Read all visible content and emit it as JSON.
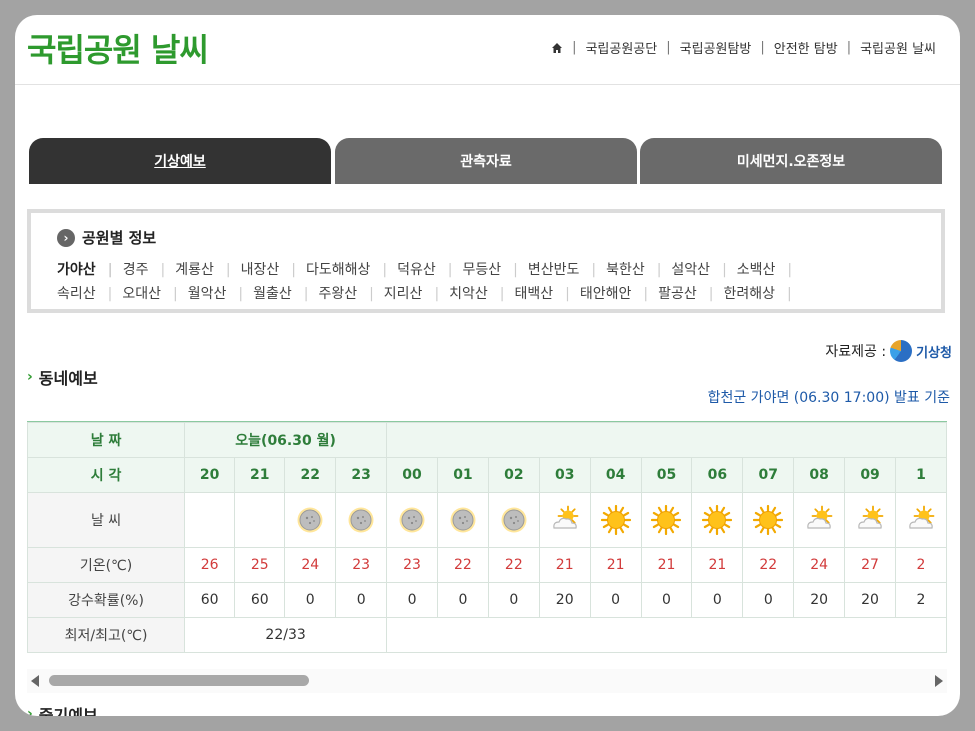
{
  "header": {
    "title": "국립공원 날씨",
    "nav": [
      "국립공원공단",
      "국립공원탐방",
      "안전한 탐방",
      "국립공원 날씨"
    ]
  },
  "tabs": [
    {
      "label": "기상예보",
      "active": true
    },
    {
      "label": "관측자료",
      "active": false
    },
    {
      "label": "미세먼지.오존정보",
      "active": false
    }
  ],
  "park_box": {
    "heading": "공원별 정보",
    "parks": [
      "가야산",
      "경주",
      "계룡산",
      "내장산",
      "다도해해상",
      "덕유산",
      "무등산",
      "변산반도",
      "북한산",
      "설악산",
      "소백산",
      "속리산",
      "오대산",
      "월악산",
      "월출산",
      "주왕산",
      "지리산",
      "치악산",
      "태백산",
      "태안해안",
      "팔공산",
      "한려해상"
    ],
    "selected": "가야산"
  },
  "credit": {
    "prefix": "자료제공 :",
    "agency": "기상청"
  },
  "forecast": {
    "section_title": "동네예보",
    "issued": "합천군 가야면 (06.30 17:00) 발표 기준",
    "labels": {
      "date": "날 짜",
      "time": "시 각",
      "weather": "날 씨",
      "temp": "기온(℃)",
      "rain": "강수확률(%)",
      "minmax": "최저/최고(℃)"
    },
    "date_today": "오늘(06.30 월)",
    "minmax_today": "22/33",
    "hours": [
      "20",
      "21",
      "22",
      "23",
      "00",
      "01",
      "02",
      "03",
      "04",
      "05",
      "06",
      "07",
      "08",
      "09",
      "1"
    ],
    "weather": [
      "none",
      "none",
      "cloudy",
      "cloudy",
      "cloudy",
      "cloudy",
      "cloudy",
      "partly-cloudy",
      "sunny",
      "sunny",
      "sunny",
      "sunny",
      "partly-cloudy",
      "partly-cloudy",
      "partly-cloudy"
    ],
    "temps": [
      "26",
      "25",
      "24",
      "23",
      "23",
      "22",
      "22",
      "21",
      "21",
      "21",
      "21",
      "22",
      "24",
      "27",
      "2"
    ],
    "rain": [
      "60",
      "60",
      "0",
      "0",
      "0",
      "0",
      "0",
      "20",
      "0",
      "0",
      "0",
      "0",
      "20",
      "20",
      "2"
    ]
  },
  "midterm": {
    "section_title": "중기예보"
  }
}
